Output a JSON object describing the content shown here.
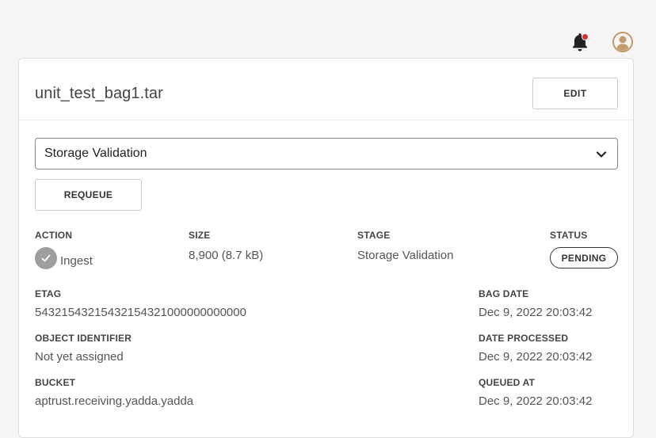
{
  "header": {
    "notification_icon": "bell-icon",
    "notification_badge_color": "#d32f2f",
    "avatar_icon": "user-circle-icon",
    "avatar_color": "#c29a6c"
  },
  "item": {
    "title": "unit_test_bag1.tar",
    "edit_label": "EDIT",
    "stage_select_value": "Storage Validation",
    "requeue_label": "REQUEUE"
  },
  "fields": {
    "action_label": "ACTION",
    "action_value": "Ingest",
    "size_label": "SIZE",
    "size_value": "8,900 (8.7 kB)",
    "stage_label": "STAGE",
    "stage_value": "Storage Validation",
    "status_label": "STATUS",
    "status_value": "PENDING",
    "etag_label": "ETAG",
    "etag_value": "54321543215432154321000000000000",
    "bag_date_label": "BAG DATE",
    "bag_date_value": "Dec 9, 2022 20:03:42",
    "object_identifier_label": "OBJECT IDENTIFIER",
    "object_identifier_value": "Not yet assigned",
    "date_processed_label": "DATE PROCESSED",
    "date_processed_value": "Dec 9, 2022 20:03:42",
    "bucket_label": "BUCKET",
    "bucket_value": "aptrust.receiving.yadda.yadda",
    "queued_at_label": "QUEUED AT",
    "queued_at_value": "Dec 9, 2022 20:03:42"
  }
}
